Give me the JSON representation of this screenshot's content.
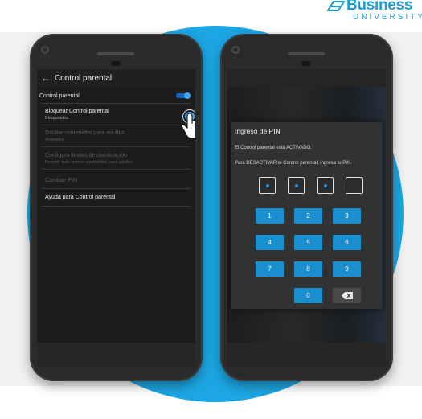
{
  "logo": {
    "brand": "Business",
    "sub": "UNIVERSITY"
  },
  "left_screen": {
    "appbar_title": "Control parental",
    "master_toggle": {
      "label": "Control parental",
      "on": true
    },
    "items": [
      {
        "title": "Bloquear Control parental",
        "subtitle": "Bloqueados",
        "enabled": true
      },
      {
        "title": "Ocultar contenidos para adultos",
        "subtitle": "Activados",
        "enabled": false
      },
      {
        "title": "Configura límites de clasificación",
        "subtitle": "Permitir todo menos contenidos para adultos",
        "enabled": false
      },
      {
        "title": "Cambiar PIN",
        "subtitle": "",
        "enabled": false
      },
      {
        "title": "Ayuda para Control parental",
        "subtitle": "",
        "enabled": true
      }
    ]
  },
  "pin_dialog": {
    "title": "Ingreso de PIN",
    "status_text": "El Control parental está ACTIVADO.",
    "instruction": "Para DESACTIVAR el Control parental, ingresa tu PIN.",
    "pin_filled": 3,
    "pin_length": 4,
    "keys": [
      "1",
      "2",
      "3",
      "4",
      "5",
      "6",
      "7",
      "8",
      "9",
      "0"
    ]
  },
  "colors": {
    "accent": "#1ca6e3",
    "key": "#1a8fd0",
    "toggle": "#42a5f5"
  }
}
